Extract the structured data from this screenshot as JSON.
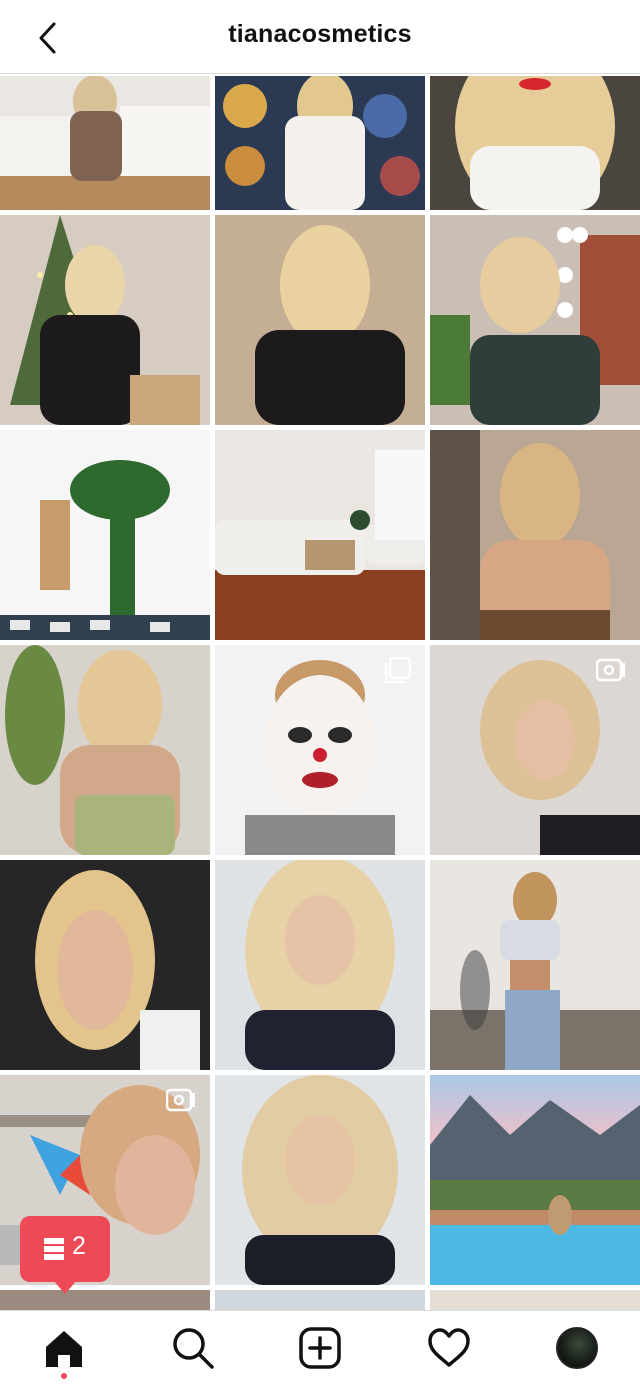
{
  "header": {
    "title": "tianacosmetics",
    "back_icon": "chevron-left-icon"
  },
  "grid": {
    "posts": [
      {
        "id": "post-1",
        "colors": [
          "#e8e2da",
          "#8a6a58"
        ],
        "media": "photo"
      },
      {
        "id": "post-2",
        "colors": [
          "#8a7a52",
          "#f1ece6"
        ],
        "media": "photo"
      },
      {
        "id": "post-3",
        "colors": [
          "#4a463f",
          "#f0ede8"
        ],
        "media": "photo"
      },
      {
        "id": "post-4",
        "colors": [
          "#d8cfc4",
          "#1f1c1c"
        ],
        "media": "photo"
      },
      {
        "id": "post-5",
        "colors": [
          "#cbb8a2",
          "#1b1818"
        ],
        "media": "photo"
      },
      {
        "id": "post-6",
        "colors": [
          "#c9bfb6",
          "#2f3a38"
        ],
        "media": "photo"
      },
      {
        "id": "post-7",
        "colors": [
          "#f3f3f3",
          "#2f6a2f"
        ],
        "media": "photo"
      },
      {
        "id": "post-8",
        "colors": [
          "#e9e6e2",
          "#7a3a1e"
        ],
        "media": "photo"
      },
      {
        "id": "post-9",
        "colors": [
          "#bfa995",
          "#6b4a32"
        ],
        "media": "photo"
      },
      {
        "id": "post-10",
        "colors": [
          "#cfcbc2",
          "#a2b07a"
        ],
        "media": "photo"
      },
      {
        "id": "post-11",
        "colors": [
          "#eeeeee",
          "#d8c9b9"
        ],
        "media": "carousel",
        "badge_icon": "carousel-icon"
      },
      {
        "id": "post-12",
        "colors": [
          "#d9d4d0",
          "#c9a98e"
        ],
        "media": "video",
        "badge_icon": "igtv-icon"
      },
      {
        "id": "post-13",
        "colors": [
          "#2a2a2a",
          "#d8b89a"
        ],
        "media": "photo"
      },
      {
        "id": "post-14",
        "colors": [
          "#dfe3e6",
          "#1f2230"
        ],
        "media": "photo"
      },
      {
        "id": "post-15",
        "colors": [
          "#e8e6e2",
          "#b9cbe0"
        ],
        "media": "photo"
      },
      {
        "id": "post-16",
        "colors": [
          "#d8d2cc",
          "#a87a5a"
        ],
        "media": "video",
        "badge_icon": "igtv-icon"
      },
      {
        "id": "post-17",
        "colors": [
          "#e3e6ea",
          "#cdb292"
        ],
        "media": "photo"
      },
      {
        "id": "post-18",
        "colors": [
          "#9aa6b6",
          "#4db6e0"
        ],
        "media": "photo"
      }
    ]
  },
  "notification": {
    "icon": "activity-icon",
    "count": "2",
    "color": "#ed4956"
  },
  "tabbar": {
    "items": [
      {
        "name": "home",
        "icon": "home-icon",
        "active": true
      },
      {
        "name": "search",
        "icon": "search-icon",
        "active": false
      },
      {
        "name": "new-post",
        "icon": "add-post-icon",
        "active": false
      },
      {
        "name": "activity",
        "icon": "heart-icon",
        "active": false
      },
      {
        "name": "profile",
        "icon": "profile-avatar-icon",
        "active": false
      }
    ]
  }
}
